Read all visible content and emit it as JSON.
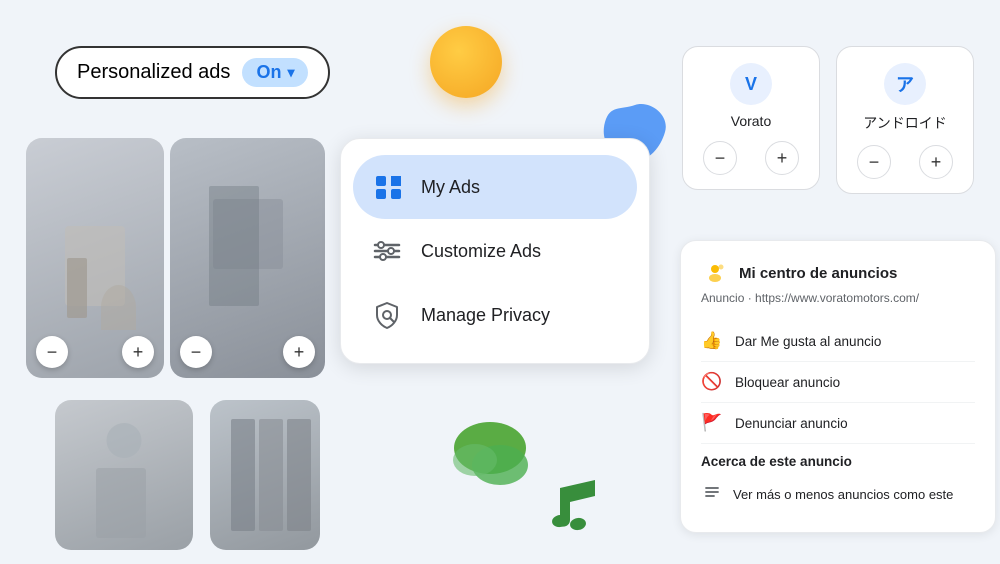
{
  "toggle": {
    "label": "Personalized ads",
    "status": "On"
  },
  "menu": {
    "items": [
      {
        "id": "my-ads",
        "label": "My Ads",
        "active": true
      },
      {
        "id": "customize-ads",
        "label": "Customize Ads",
        "active": false
      },
      {
        "id": "manage-privacy",
        "label": "Manage Privacy",
        "active": false
      }
    ]
  },
  "vocab_cards": [
    {
      "avatar_text": "V",
      "name": "Vorato",
      "minus_label": "−",
      "plus_label": "+"
    },
    {
      "avatar_text": "ア",
      "name": "アンドロイド",
      "minus_label": "−",
      "plus_label": "+"
    }
  ],
  "ad_center": {
    "title": "Mi centro de anuncios",
    "advertiser": "Anuncio · https://www.voratomotors.com/",
    "actions": [
      {
        "icon": "👍",
        "label": "Dar Me gusta al anuncio"
      },
      {
        "icon": "🚫",
        "label": "Bloquear anuncio"
      },
      {
        "icon": "🚩",
        "label": "Denunciar anuncio"
      }
    ],
    "section_title": "Acerca de este anuncio",
    "more_actions": [
      {
        "icon": "⇅",
        "label": "Ver más o menos anuncios como este"
      }
    ]
  }
}
